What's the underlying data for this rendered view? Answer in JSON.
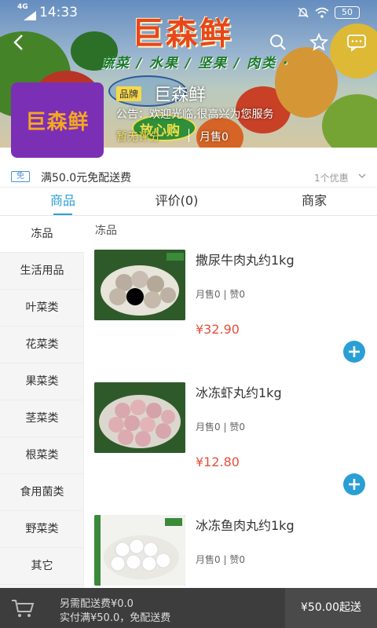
{
  "status_bar": {
    "network": "4G",
    "time": "14:33",
    "battery": "50"
  },
  "banner": {
    "title": "巨森鲜",
    "tags": "蔬菜 / 水果 / 坚果 / 肉类 ·",
    "fangxin": "放心购"
  },
  "store": {
    "logo_text": "巨森鲜",
    "brand_badge": "品牌",
    "name": "巨森鲜",
    "notice": "公告：欢迎光临,很高兴为您服务",
    "rating": "暂无评分",
    "monthly_sales": "月售0"
  },
  "promo": {
    "tag": "免",
    "text": "满50.0元免配送费",
    "count": "1个优惠"
  },
  "tabs": [
    {
      "label": "商品"
    },
    {
      "label": "评价(0)"
    },
    {
      "label": "商家"
    }
  ],
  "sidebar": {
    "items": [
      {
        "label": "冻品"
      },
      {
        "label": "生活用品"
      },
      {
        "label": "叶菜类"
      },
      {
        "label": "花菜类"
      },
      {
        "label": "果菜类"
      },
      {
        "label": "茎菜类"
      },
      {
        "label": "根菜类"
      },
      {
        "label": "食用菌类"
      },
      {
        "label": "野菜类"
      },
      {
        "label": "其它"
      }
    ]
  },
  "content": {
    "section_title": "冻品",
    "products": [
      {
        "name": "撒尿牛肉丸约1kg",
        "sales": "月售0",
        "likes": "赞0",
        "price": "¥32.90"
      },
      {
        "name": "冰冻虾丸约1kg",
        "sales": "月售0",
        "likes": "赞0",
        "price": "¥12.80"
      },
      {
        "name": "冰冻鱼肉丸约1kg",
        "sales": "月售0",
        "likes": "赞0",
        "price": ""
      }
    ]
  },
  "cart": {
    "line1": "另需配送费¥0.0",
    "line2": "实付满¥50.0，免配送费",
    "checkout": "¥50.00起送"
  },
  "colors": {
    "accent": "#2a9fd6",
    "price": "#e5503c",
    "logo_bg": "#7b2fb5",
    "cart_bar": "#3d3d3d"
  }
}
